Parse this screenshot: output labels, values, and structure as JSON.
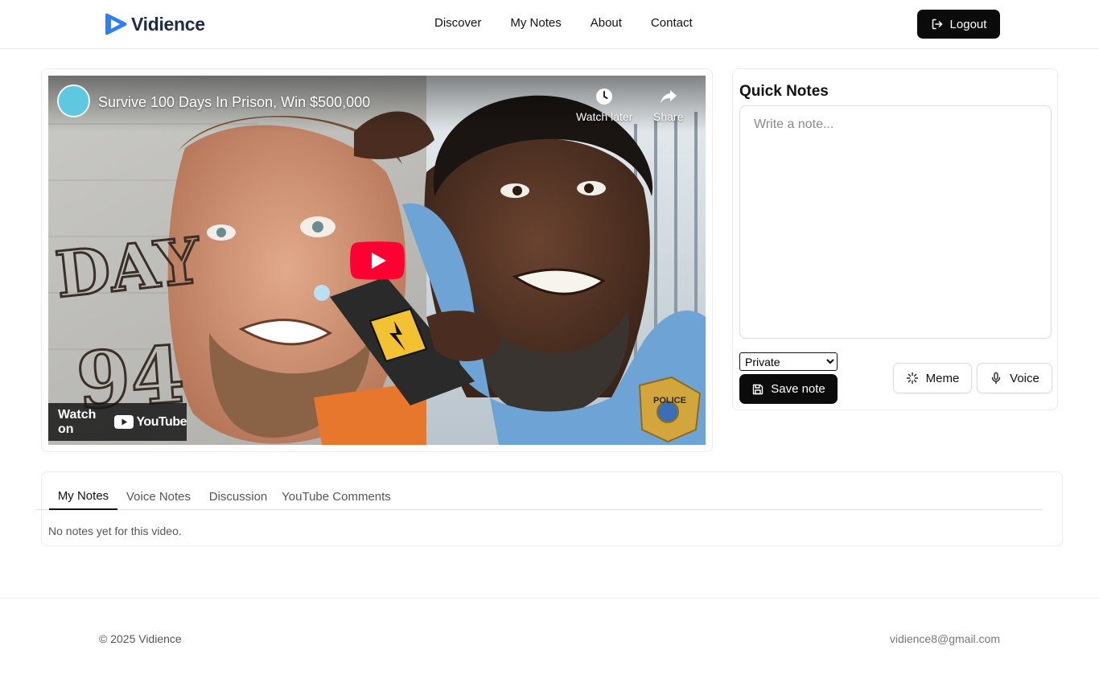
{
  "brand": {
    "name": "Vidience",
    "color": "#2f80ed"
  },
  "nav": {
    "items": [
      "Discover",
      "My Notes",
      "About",
      "Contact"
    ],
    "logout_label": "Logout"
  },
  "video": {
    "title": "Survive 100 Days In Prison, Win $500,000",
    "watch_later_label": "Watch later",
    "share_label": "Share",
    "watch_on_label": "Watch on",
    "youtube_label": "YouTube",
    "thumbnail_text_line1": "DAY",
    "thumbnail_text_line2": "94",
    "badge_text": "POLICE"
  },
  "quick_notes": {
    "title": "Quick Notes",
    "placeholder": "Write a note...",
    "visibility_selected": "Private",
    "save_label": "Save note",
    "meme_label": "Meme",
    "voice_label": "Voice"
  },
  "tabs": {
    "items": [
      "My Notes",
      "Voice Notes",
      "Discussion",
      "YouTube Comments"
    ],
    "active": "My Notes",
    "empty_message": "No notes yet for this video."
  },
  "footer": {
    "copyright": "© 2025 Vidience",
    "email": "vidience8@gmail.com"
  },
  "colors": {
    "primary_button": "#0b0b0b",
    "youtube_red": "#ff0033"
  }
}
